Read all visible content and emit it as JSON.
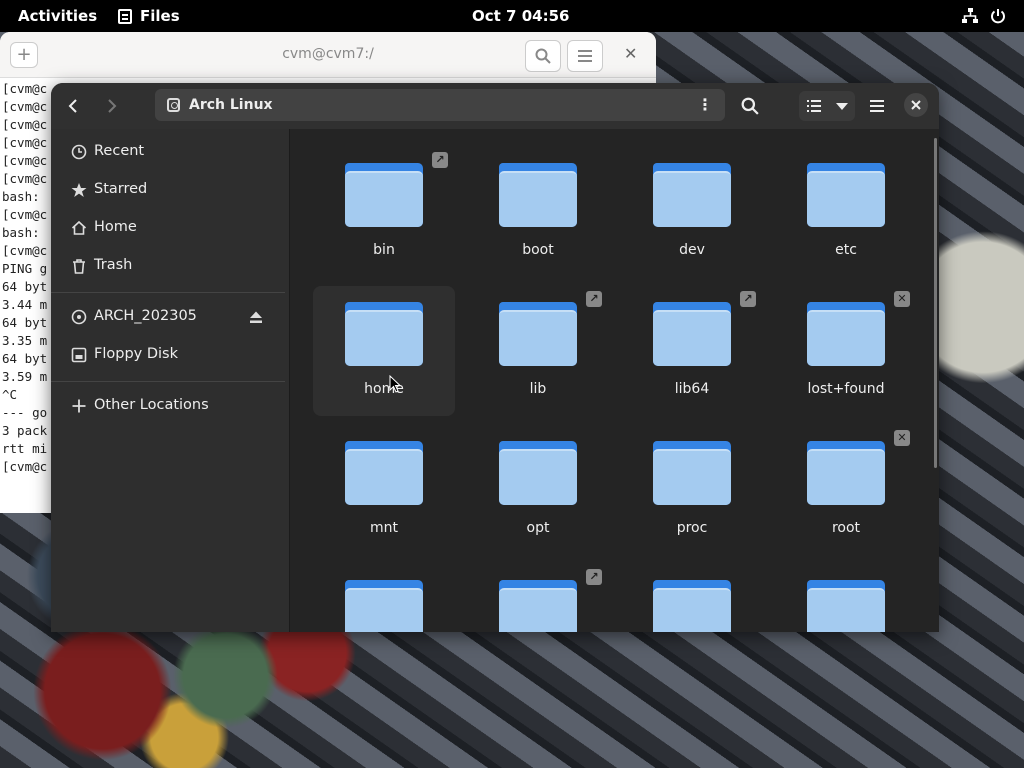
{
  "topbar": {
    "activities": "Activities",
    "app_name": "Files",
    "clock": "Oct 7  04:56",
    "icons": [
      "network-icon",
      "power-icon"
    ]
  },
  "terminal": {
    "title": "cvm@cvm7:/",
    "lines": [
      "[cvm@c",
      "[cvm@c",
      "[cvm@c",
      "[cvm@c",
      "[cvm@c",
      "[cvm@c",
      "bash:",
      "[cvm@c",
      "bash:",
      "[cvm@c",
      "PING g",
      "64 byt",
      "3.44 m",
      "64 byt",
      "3.35 m",
      "64 byt",
      "3.59 m",
      "^C",
      "--- go",
      "3 pack",
      "rtt mi",
      "[cvm@c"
    ]
  },
  "files": {
    "location": "Arch Linux",
    "sidebar": {
      "items": [
        {
          "label": "Recent",
          "icon": "clock-icon"
        },
        {
          "label": "Starred",
          "icon": "star-icon"
        },
        {
          "label": "Home",
          "icon": "home-icon"
        },
        {
          "label": "Trash",
          "icon": "trash-icon"
        }
      ],
      "devices": [
        {
          "label": "ARCH_202305",
          "icon": "disc-icon"
        },
        {
          "label": "Floppy Disk",
          "icon": "floppy-icon"
        }
      ],
      "other": {
        "label": "Other Locations",
        "icon": "plus-icon"
      }
    },
    "folders": [
      {
        "name": "bin",
        "emblem": "link"
      },
      {
        "name": "boot",
        "emblem": ""
      },
      {
        "name": "dev",
        "emblem": ""
      },
      {
        "name": "etc",
        "emblem": ""
      },
      {
        "name": "home",
        "emblem": ""
      },
      {
        "name": "lib",
        "emblem": "link"
      },
      {
        "name": "lib64",
        "emblem": "link"
      },
      {
        "name": "lost+found",
        "emblem": "locked"
      },
      {
        "name": "mnt",
        "emblem": ""
      },
      {
        "name": "opt",
        "emblem": ""
      },
      {
        "name": "proc",
        "emblem": ""
      },
      {
        "name": "root",
        "emblem": "locked"
      },
      {
        "name": "",
        "emblem": ""
      },
      {
        "name": "",
        "emblem": "link"
      },
      {
        "name": "",
        "emblem": ""
      },
      {
        "name": "",
        "emblem": ""
      }
    ],
    "colors": {
      "folder_back": "#3584e4",
      "folder_front": "#a4cbf0",
      "window_bg": "#242424",
      "sidebar_bg": "#2e2e2e"
    }
  }
}
